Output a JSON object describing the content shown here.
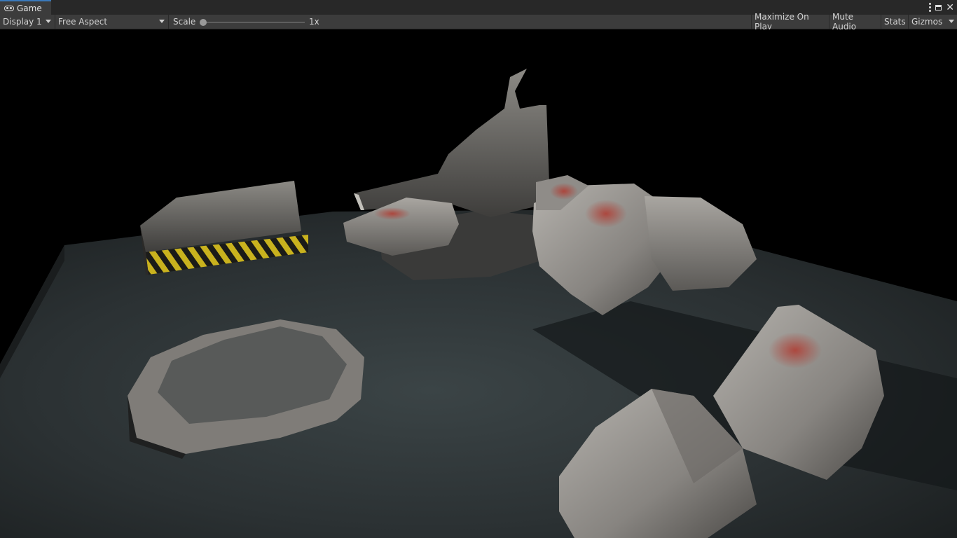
{
  "tab": {
    "title": "Game",
    "icon": "gamepad-icon"
  },
  "window_controls": {
    "menu_icon": "kebab-menu-icon",
    "maximize_icon": "maximize-icon",
    "close_icon": "close-icon"
  },
  "toolbar": {
    "display": "Display 1",
    "aspect": "Free Aspect",
    "scale_label": "Scale",
    "scale_value": "1x",
    "maximize_on_play": "Maximize On Play",
    "mute_audio": "Mute Audio",
    "stats": "Stats",
    "gizmos": "Gizmos"
  },
  "viewport": {
    "background": "#000000",
    "scene": "3D rubble scene with concrete platform, rocks and broken wall"
  }
}
